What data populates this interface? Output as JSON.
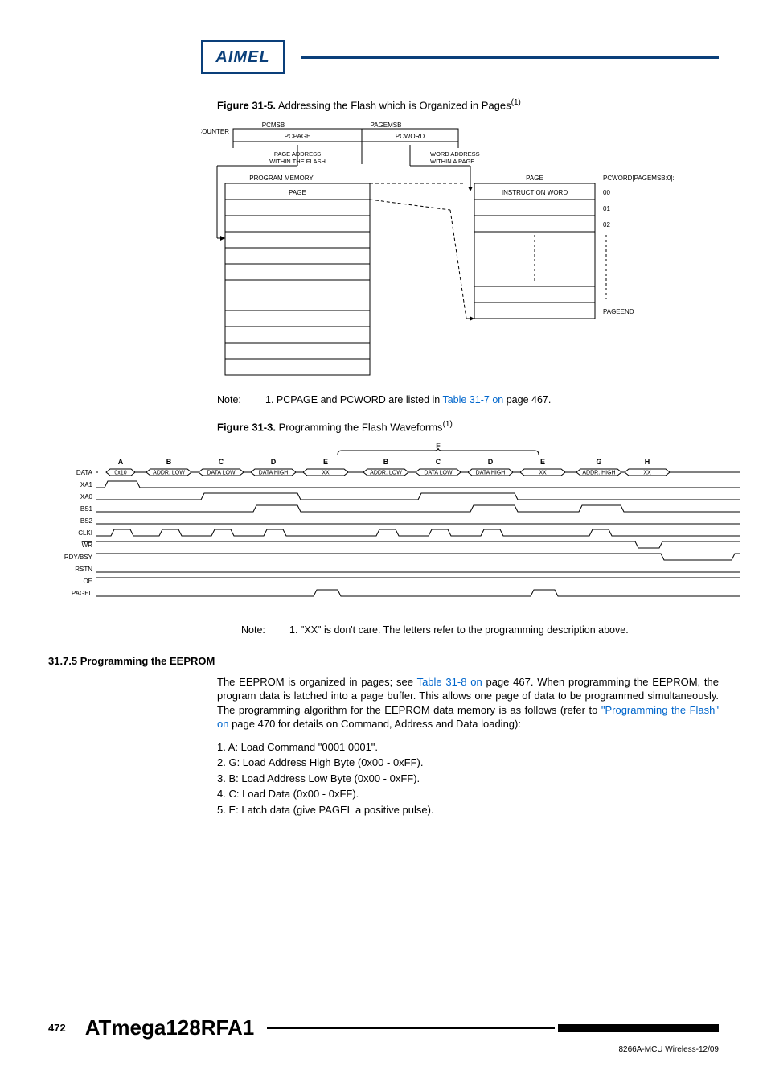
{
  "logo_text": "AIMEL",
  "figure1": {
    "caption_prefix": "Figure 31-5.",
    "caption_text": " Addressing the Flash which is Organized in Pages",
    "sup": "(1)",
    "labels": {
      "pcmsb": "PCMSB",
      "pagemsb": "PAGEMSB",
      "program_counter": "PROGRAM COUNTER",
      "pcpage": "PCPAGE",
      "pcword": "PCWORD",
      "page_addr": "PAGE ADDRESS WITHIN THE FLASH",
      "word_addr": "WORD ADDRESS WITHIN A PAGE",
      "prog_mem": "PROGRAM MEMORY",
      "page": "PAGE",
      "page_right": "PAGE",
      "pcword_col": "PCWORD[PAGEMSB:0]:",
      "r00": "00",
      "r01": "01",
      "r02": "02",
      "pageend": "PAGEEND",
      "instr_word": "INSTRUCTION WORD"
    },
    "note_label": "Note:",
    "note_num": "1.",
    "note_a": "PCPAGE and PCWORD are listed in ",
    "note_link": "Table 31-7 on",
    "note_b": " page 467."
  },
  "figure2": {
    "caption_prefix": "Figure 31-3.",
    "caption_text": " Programming the Flash Waveforms",
    "sup": "(1)",
    "top_letters": [
      "A",
      "B",
      "C",
      "D",
      "E",
      "B",
      "C",
      "D",
      "E",
      "G",
      "H"
    ],
    "f_label": "F",
    "rows": [
      "DATA",
      "XA1",
      "XA0",
      "BS1",
      "BS2",
      "CLKI",
      "WR",
      "RDY/BSY",
      "RSTN",
      "OE",
      "PAGEL"
    ],
    "data_segments": [
      "0x10",
      "ADDR. LOW",
      "DATA LOW",
      "DATA HIGH",
      "XX",
      "ADDR. LOW",
      "DATA LOW",
      "DATA HIGH",
      "XX",
      "ADDR. HIGH",
      "XX"
    ],
    "note_label": "Note:",
    "note_num": "1.",
    "note_text": "\"XX\" is don't care. The letters refer to the programming description above."
  },
  "section": {
    "heading": "31.7.5 Programming the EEPROM",
    "para_a": "The EEPROM is organized in pages; see ",
    "para_link1": "Table 31-8 on",
    "para_b": " page 467. When programming the EEPROM, the program data is latched into a page buffer. This allows one page of data to be programmed simultaneously. The programming algorithm for the EEPROM data memory is as follows (refer to ",
    "para_link2": "\"Programming the Flash\" on",
    "para_c": " page 470 for details on Command, Address and Data loading):",
    "steps": [
      "1. A: Load Command \"0001 0001\".",
      "2. G: Load Address High Byte (0x00 - 0xFF).",
      "3. B: Load Address Low Byte (0x00 - 0xFF).",
      "4. C: Load Data (0x00 - 0xFF).",
      "5. E: Latch data (give PAGEL a positive pulse)."
    ]
  },
  "footer": {
    "page": "472",
    "chip": "ATmega128RFA1",
    "docid": "8266A-MCU Wireless-12/09"
  }
}
